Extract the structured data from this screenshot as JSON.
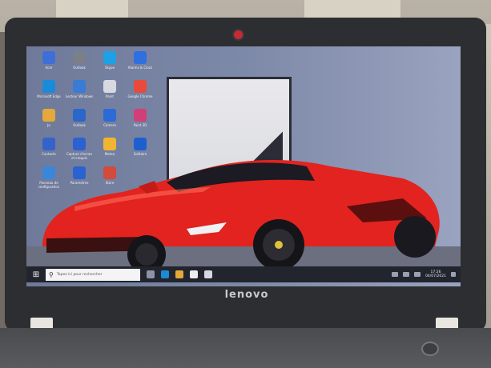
{
  "laptop": {
    "brand": "lenovo"
  },
  "desktop_icons": [
    {
      "label": "Acer",
      "icon": "app-icon",
      "color": "#3e6fd8"
    },
    {
      "label": "Outlook",
      "icon": "app-icon",
      "color": "#7a7f8a"
    },
    {
      "label": "Skype",
      "icon": "skype-icon",
      "color": "#1da0e6"
    },
    {
      "label": "Alarms & Clock",
      "icon": "clock-icon",
      "color": "#2f6fe0"
    },
    {
      "label": "Microsoft Edge",
      "icon": "edge-icon",
      "color": "#1a8bd8"
    },
    {
      "label": "Lecteur Windows",
      "icon": "media-icon",
      "color": "#3a7bd5"
    },
    {
      "label": "Paint",
      "icon": "paint-icon",
      "color": "#d8d8e0"
    },
    {
      "label": "Google Chrome",
      "icon": "chrome-icon",
      "color": "#e84b3c"
    },
    {
      "label": "Jo",
      "icon": "folder-icon",
      "color": "#e4a93a"
    },
    {
      "label": "Outlook",
      "icon": "app-icon",
      "color": "#2a67c9"
    },
    {
      "label": "Camera",
      "icon": "camera-icon",
      "color": "#2c6ad8"
    },
    {
      "label": "Paint 3D",
      "icon": "paint3d-icon",
      "color": "#d23f78"
    },
    {
      "label": "Contacts",
      "icon": "contacts-icon",
      "color": "#3563c9"
    },
    {
      "label": "Capture d'ecran et croquis",
      "icon": "snip-icon",
      "color": "#2e61d0"
    },
    {
      "label": "Meteo",
      "icon": "weather-icon",
      "color": "#f2b531"
    },
    {
      "label": "Solitaire",
      "icon": "cards-icon",
      "color": "#1e5fd0"
    },
    {
      "label": "Panneau de configuration",
      "icon": "control-panel-icon",
      "color": "#3a86d9"
    },
    {
      "label": "Parametres",
      "icon": "gear-icon",
      "color": "#2a62d1"
    },
    {
      "label": "Store",
      "icon": "store-icon",
      "color": "#d24b3b"
    }
  ],
  "taskbar": {
    "search_placeholder": "Tapez ici pour rechercher",
    "clock_time": "17:26",
    "clock_date": "04/07/2021"
  },
  "colors": {
    "car_red": "#e2231f",
    "taskbar_bg": "#22252d",
    "webcam_light": "#c62b33"
  }
}
